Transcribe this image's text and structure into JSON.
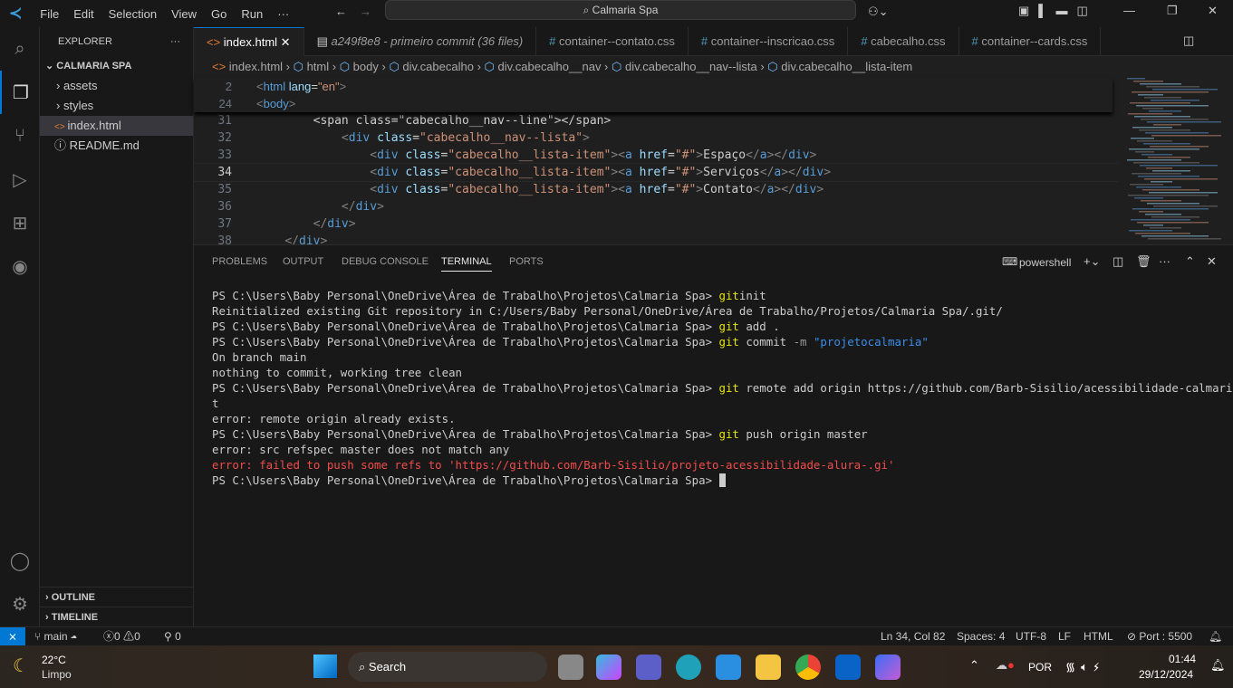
{
  "titlebar": {
    "menus": [
      "File",
      "Edit",
      "Selection",
      "View",
      "Go",
      "Run",
      "···"
    ],
    "search": "Calmaria Spa"
  },
  "explorer": {
    "title": "EXPLORER",
    "project": "CALMARIA SPA",
    "items": [
      {
        "label": "assets",
        "icon": "chevron-right-icon"
      },
      {
        "label": "styles",
        "icon": "chevron-right-icon"
      },
      {
        "label": "index.html",
        "icon": "html-icon"
      },
      {
        "label": "README.md",
        "icon": "info-icon"
      }
    ],
    "outline": "OUTLINE",
    "timeline": "TIMELINE"
  },
  "tabs": [
    {
      "label": "index.html",
      "icon": "<>"
    },
    {
      "label": "a249f8e8 - primeiro commit (36 files)",
      "icon": "▤"
    },
    {
      "label": "container--contato.css",
      "icon": "#"
    },
    {
      "label": "container--inscricao.css",
      "icon": "#"
    },
    {
      "label": "cabecalho.css",
      "icon": "#"
    },
    {
      "label": "container--cards.css",
      "icon": "#"
    }
  ],
  "breadcrumb": [
    "index.html",
    "html",
    "body",
    "div.cabecalho",
    "div.cabecalho__nav",
    "div.cabecalho__nav--lista",
    "div.cabecalho__lista-item"
  ],
  "sticky": [
    {
      "n": "2",
      "code": [
        [
          "tg",
          "<"
        ],
        [
          "tn",
          "html "
        ],
        [
          "at",
          "lang"
        ],
        [
          "tx",
          "="
        ],
        [
          "st",
          "\"en\""
        ],
        [
          "tg",
          ">"
        ]
      ]
    },
    {
      "n": "24",
      "code": [
        [
          "tg",
          "<"
        ],
        [
          "tn",
          "body"
        ],
        [
          "tg",
          ">"
        ]
      ]
    }
  ],
  "code": [
    {
      "n": "31",
      "code": [
        [
          "tx",
          "        <span class=\"cabecalho__nav--line\"></span>"
        ]
      ]
    },
    {
      "n": "32",
      "code": [
        [
          "tx",
          "            "
        ],
        [
          "tg",
          "<"
        ],
        [
          "tn",
          "div "
        ],
        [
          "at",
          "class"
        ],
        [
          "tx",
          "="
        ],
        [
          "st",
          "\"cabecalho__nav--lista\""
        ],
        [
          "tg",
          ">"
        ]
      ]
    },
    {
      "n": "33",
      "code": [
        [
          "tx",
          "                "
        ],
        [
          "tg",
          "<"
        ],
        [
          "tn",
          "div "
        ],
        [
          "at",
          "class"
        ],
        [
          "tx",
          "="
        ],
        [
          "st",
          "\"cabecalho__lista-item\""
        ],
        [
          "tg",
          "><"
        ],
        [
          "tn",
          "a "
        ],
        [
          "at",
          "href"
        ],
        [
          "tx",
          "="
        ],
        [
          "st",
          "\"#\""
        ],
        [
          "tg",
          ">"
        ],
        [
          "tx",
          "Espaço"
        ],
        [
          "tg",
          "</"
        ],
        [
          "tn",
          "a"
        ],
        [
          "tg",
          "></"
        ],
        [
          "tn",
          "div"
        ],
        [
          "tg",
          ">"
        ]
      ]
    },
    {
      "n": "34",
      "code": [
        [
          "tx",
          "                "
        ],
        [
          "tg",
          "<"
        ],
        [
          "tn",
          "div "
        ],
        [
          "at",
          "class"
        ],
        [
          "tx",
          "="
        ],
        [
          "st",
          "\"cabecalho__lista-item\""
        ],
        [
          "tg",
          "><"
        ],
        [
          "tn",
          "a "
        ],
        [
          "at",
          "href"
        ],
        [
          "tx",
          "="
        ],
        [
          "st",
          "\"#\""
        ],
        [
          "tg",
          ">"
        ],
        [
          "tx",
          "Serviços"
        ],
        [
          "tg",
          "</"
        ],
        [
          "tn",
          "a"
        ],
        [
          "tg",
          "></"
        ],
        [
          "tn",
          "div"
        ],
        [
          "tg",
          ">"
        ]
      ]
    },
    {
      "n": "35",
      "code": [
        [
          "tx",
          "                "
        ],
        [
          "tg",
          "<"
        ],
        [
          "tn",
          "div "
        ],
        [
          "at",
          "class"
        ],
        [
          "tx",
          "="
        ],
        [
          "st",
          "\"cabecalho__lista-item\""
        ],
        [
          "tg",
          "><"
        ],
        [
          "tn",
          "a "
        ],
        [
          "at",
          "href"
        ],
        [
          "tx",
          "="
        ],
        [
          "st",
          "\"#\""
        ],
        [
          "tg",
          ">"
        ],
        [
          "tx",
          "Contato"
        ],
        [
          "tg",
          "</"
        ],
        [
          "tn",
          "a"
        ],
        [
          "tg",
          "></"
        ],
        [
          "tn",
          "div"
        ],
        [
          "tg",
          ">"
        ]
      ]
    },
    {
      "n": "36",
      "code": [
        [
          "tx",
          "            "
        ],
        [
          "tg",
          "</"
        ],
        [
          "tn",
          "div"
        ],
        [
          "tg",
          ">"
        ]
      ]
    },
    {
      "n": "37",
      "code": [
        [
          "tx",
          "        "
        ],
        [
          "tg",
          "</"
        ],
        [
          "tn",
          "div"
        ],
        [
          "tg",
          ">"
        ]
      ]
    },
    {
      "n": "38",
      "code": [
        [
          "tx",
          "    "
        ],
        [
          "tg",
          "</"
        ],
        [
          "tn",
          "div"
        ],
        [
          "tg",
          ">"
        ]
      ]
    },
    {
      "n": "39",
      "code": [
        [
          "tx",
          ""
        ]
      ]
    }
  ],
  "current_line": "34",
  "panel": {
    "tabs": [
      "PROBLEMS",
      "OUTPUT",
      "DEBUG CONSOLE",
      "TERMINAL",
      "PORTS"
    ],
    "active": "TERMINAL",
    "shell": "powershell"
  },
  "terminal": [
    [
      [
        "",
        "PS C:\\Users\\Baby Personal\\OneDrive\\Área de Trabalho\\Projetos\\Calmaria Spa> "
      ],
      [
        "y",
        "git"
      ],
      [
        "",
        "init"
      ]
    ],
    [
      [
        "",
        "Reinitialized existing Git repository in C:/Users/Baby Personal/OneDrive/Área de Trabalho/Projetos/Calmaria Spa/.git/"
      ]
    ],
    [
      [
        "",
        "PS C:\\Users\\Baby Personal\\OneDrive\\Área de Trabalho\\Projetos\\Calmaria Spa> "
      ],
      [
        "y",
        "git"
      ],
      [
        "",
        " add ."
      ]
    ],
    [
      [
        "",
        "PS C:\\Users\\Baby Personal\\OneDrive\\Área de Trabalho\\Projetos\\Calmaria Spa> "
      ],
      [
        "y",
        "git"
      ],
      [
        "",
        " commit "
      ],
      [
        "g",
        "-m"
      ],
      [
        "b",
        " \"projetocalmaria\""
      ]
    ],
    [
      [
        "",
        "On branch main"
      ]
    ],
    [
      [
        "",
        "nothing to commit, working tree clean"
      ]
    ],
    [
      [
        "",
        "PS C:\\Users\\Baby Personal\\OneDrive\\Área de Trabalho\\Projetos\\Calmaria Spa> "
      ],
      [
        "y",
        "git"
      ],
      [
        "",
        " remote add origin https://github.com/Barb-Sisilio/acessibilidade-calmaria-css.gi"
      ]
    ],
    [
      [
        "",
        "t"
      ]
    ],
    [
      [
        "",
        "error: remote origin already exists."
      ]
    ],
    [
      [
        "",
        "PS C:\\Users\\Baby Personal\\OneDrive\\Área de Trabalho\\Projetos\\Calmaria Spa> "
      ],
      [
        "y",
        "git"
      ],
      [
        "",
        " push origin master"
      ]
    ],
    [
      [
        "",
        "error: src refspec master does not match any"
      ]
    ],
    [
      [
        "r",
        "error: failed to push some refs to 'https://github.com/Barb-Sisilio/projeto-acessibilidade-alura-.gi'"
      ]
    ],
    [
      [
        "",
        "PS C:\\Users\\Baby Personal\\OneDrive\\Área de Trabalho\\Projetos\\Calmaria Spa> "
      ]
    ]
  ],
  "status": {
    "branch": "main",
    "errors": "0",
    "warnings": "0",
    "ports": "0",
    "position": "Ln 34, Col 82",
    "spaces": "Spaces: 4",
    "encoding": "UTF-8",
    "eol": "LF",
    "language": "HTML",
    "port": "Port : 5500"
  },
  "taskbar": {
    "temp": "22°C",
    "weather": "Limpo",
    "search": "Search",
    "lang": "POR",
    "time": "01:44",
    "date": "29/12/2024"
  },
  "colors": {
    "accent": "#0078d4",
    "status_remote": "#0078d4"
  }
}
